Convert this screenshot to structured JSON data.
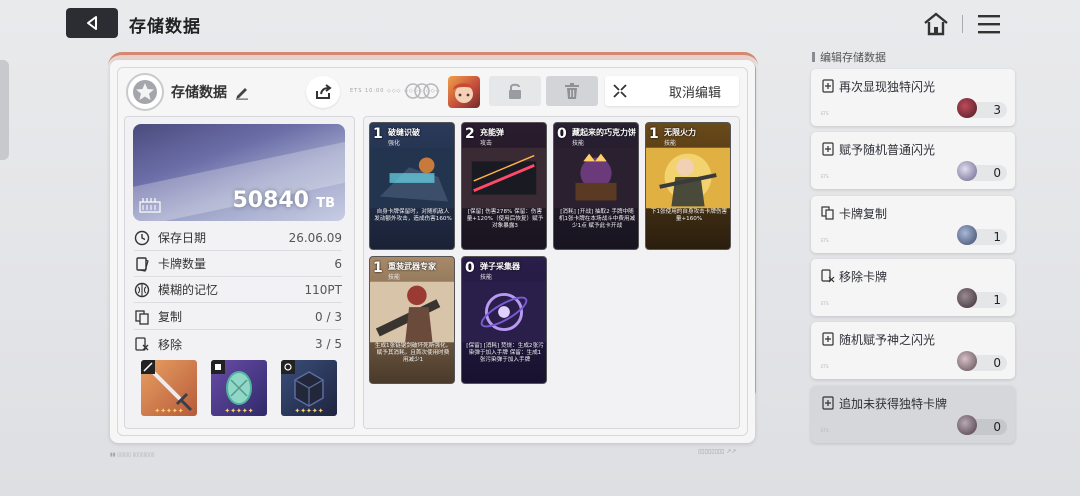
{
  "header": {
    "title": "存储数据"
  },
  "panel": {
    "name": "存储数据",
    "cancel_label": "取消编辑",
    "deco_text": "ETS 10:00 ◇◇◇ ◇◇◇◇ ◇◇◇"
  },
  "storage": {
    "value": "50840",
    "unit": "TB"
  },
  "stats": [
    {
      "key": "保存日期",
      "value": "26.06.09"
    },
    {
      "key": "卡牌数量",
      "value": "6"
    },
    {
      "key": "模糊的记忆",
      "value": "110PT"
    },
    {
      "key": "复制",
      "value": "0 / 3"
    },
    {
      "key": "移除",
      "value": "3 / 5"
    }
  ],
  "relics": [
    {
      "stars": "✦✦✦✦✦"
    },
    {
      "stars": "✦✦✦✦✦"
    },
    {
      "stars": "✦✦✦✦✦"
    }
  ],
  "cards": [
    {
      "cost": "1",
      "name": "破缝识破",
      "type": "强化",
      "desc": "自身卡牌保留时，对随机敌人发动额外攻击，造成伤害160%"
    },
    {
      "cost": "2",
      "name": "充能弹",
      "type": "攻击",
      "desc": "[保留] 伤害278% 保留：伤害量+120%（使用后恢复）赋予对象暴露3"
    },
    {
      "cost": "0",
      "name": "藏起来的巧克力饼",
      "type": "技能",
      "desc": "[消耗] [开战] 抽取2 手牌中随机1张卡牌在本场战斗中费用减少1点 赋予此卡开战"
    },
    {
      "cost": "1",
      "name": "无限火力",
      "type": "技能",
      "desc": "下1张使用的自身攻击卡牌伤害量+160%"
    },
    {
      "cost": "1",
      "name": "重装武器专家",
      "type": "技能",
      "desc": "生成1张链锯剑破坏死斯强化，赋予其消耗，且首次使用时费用减少1"
    },
    {
      "cost": "0",
      "name": "弹子采集器",
      "type": "技能",
      "desc": "[保留] [消耗] 焚烧：生成2张污染弹于加入手牌 保留：生成1张污染弹于加入手牌"
    }
  ],
  "sidebar": {
    "title": "编辑存储数据",
    "options": [
      {
        "label": "再次显现独特闪光",
        "count": "3",
        "gem_color": "#8a2a3c"
      },
      {
        "label": "赋予随机普通闪光",
        "count": "0",
        "gem_color": "#9a8fb5"
      },
      {
        "label": "卡牌复制",
        "count": "1",
        "gem_color": "#5a6a8a"
      },
      {
        "label": "移除卡牌",
        "count": "1",
        "gem_color": "#5a4a52"
      },
      {
        "label": "随机赋予神之闪光",
        "count": "0",
        "gem_color": "#7a6a72"
      },
      {
        "label": "追加未获得独特卡牌",
        "count": "0",
        "gem_color": "#6a5a66"
      }
    ]
  },
  "colors": {
    "accent": "#d48872",
    "dark": "#2c2d33"
  }
}
